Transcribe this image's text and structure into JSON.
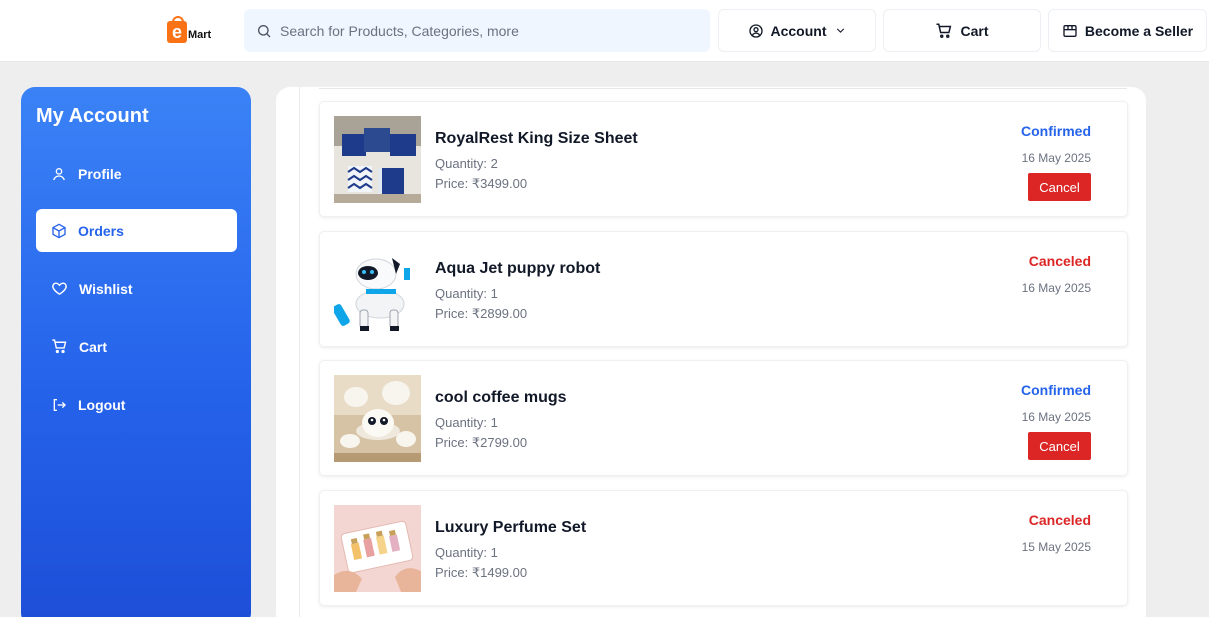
{
  "header": {
    "logo_letter": "e",
    "logo_text": "Mart",
    "search": {
      "placeholder": "Search for Products, Categories, more",
      "value": ""
    },
    "account_label": "Account",
    "cart_label": "Cart",
    "seller_label": "Become a Seller"
  },
  "sidebar": {
    "title": "My Account",
    "items": [
      {
        "label": "Profile",
        "icon": "user-icon",
        "active": false
      },
      {
        "label": "Orders",
        "icon": "package-icon",
        "active": true
      },
      {
        "label": "Wishlist",
        "icon": "heart-icon",
        "active": false
      },
      {
        "label": "Cart",
        "icon": "cart-icon",
        "active": false
      },
      {
        "label": "Logout",
        "icon": "logout-icon",
        "active": false
      }
    ]
  },
  "orders": [
    {
      "name": "RoyalRest King Size Sheet",
      "quantity": "Quantity: 2",
      "price": "Price: ₹3499.00",
      "status": "Confirmed",
      "date": "16 May 2025",
      "cancel_label": "Cancel",
      "image": "bed-sheet-image"
    },
    {
      "name": "Aqua Jet puppy robot",
      "quantity": "Quantity: 1",
      "price": "Price: ₹2899.00",
      "status": "Canceled",
      "date": "16 May 2025",
      "image": "robot-dog-image"
    },
    {
      "name": "cool coffee mugs",
      "quantity": "Quantity: 1",
      "price": "Price: ₹2799.00",
      "status": "Confirmed",
      "date": "16 May 2025",
      "cancel_label": "Cancel",
      "image": "coffee-mugs-image"
    },
    {
      "name": "Luxury Perfume Set",
      "quantity": "Quantity: 1",
      "price": "Price: ₹1499.00",
      "status": "Canceled",
      "date": "15 May 2025",
      "image": "perfume-set-image"
    }
  ],
  "colors": {
    "accent": "#2563eb",
    "confirmed": "#2563eb",
    "canceled": "#dc2626",
    "cancel_button": "#dc2626",
    "logo": "#f97316"
  }
}
